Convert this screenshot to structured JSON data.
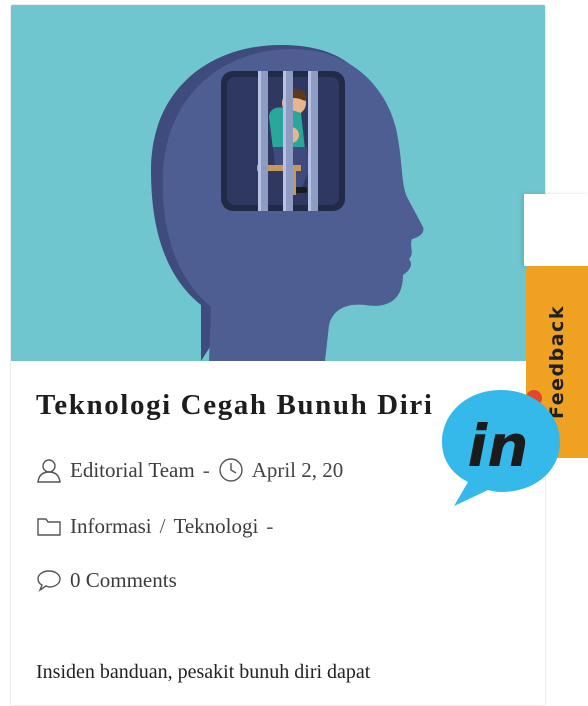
{
  "post": {
    "title": "Teknologi Cegah Bunuh Diri",
    "author": "Editorial Team",
    "separator": "-",
    "date": "April 2, 20",
    "categories": [
      "Informasi",
      "Teknologi"
    ],
    "category_separator": "/",
    "trailing_separator": "-",
    "comments": "0 Comments",
    "excerpt": "Insiden banduan, pesakit bunuh diri dapat"
  },
  "feedback_tab": {
    "label": "Feedback",
    "color": "#efa221"
  },
  "chat_widget": {
    "glyph": "in",
    "color": "#35b9ea"
  },
  "colors": {
    "hero_bg": "#6fc6ce",
    "head": "#4f5e92",
    "title": "#1d1d1d"
  },
  "icons": {
    "author": "user-icon",
    "date": "clock-icon",
    "category": "folder-icon",
    "comments": "comment-icon"
  }
}
